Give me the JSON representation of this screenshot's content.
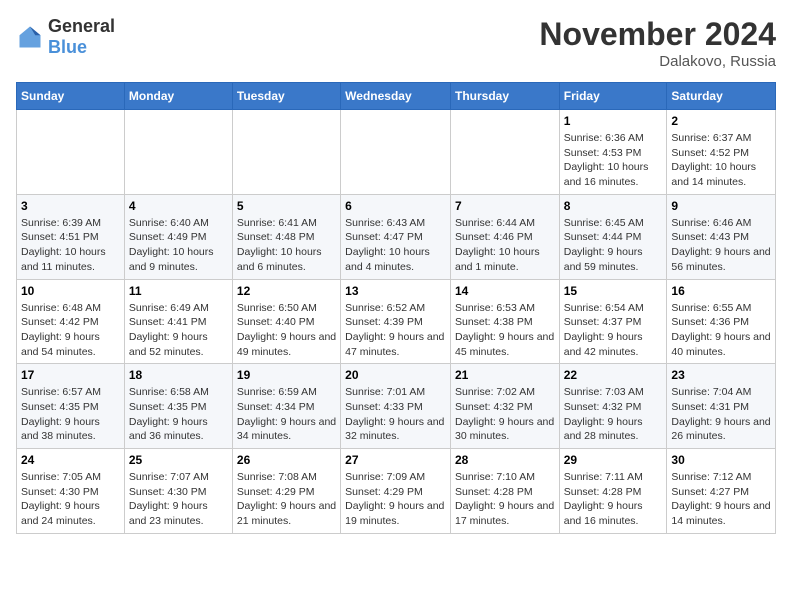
{
  "logo": {
    "general": "General",
    "blue": "Blue"
  },
  "title": "November 2024",
  "location": "Dalakovo, Russia",
  "days_header": [
    "Sunday",
    "Monday",
    "Tuesday",
    "Wednesday",
    "Thursday",
    "Friday",
    "Saturday"
  ],
  "weeks": [
    [
      {
        "day": "",
        "info": ""
      },
      {
        "day": "",
        "info": ""
      },
      {
        "day": "",
        "info": ""
      },
      {
        "day": "",
        "info": ""
      },
      {
        "day": "",
        "info": ""
      },
      {
        "day": "1",
        "info": "Sunrise: 6:36 AM\nSunset: 4:53 PM\nDaylight: 10 hours and 16 minutes."
      },
      {
        "day": "2",
        "info": "Sunrise: 6:37 AM\nSunset: 4:52 PM\nDaylight: 10 hours and 14 minutes."
      }
    ],
    [
      {
        "day": "3",
        "info": "Sunrise: 6:39 AM\nSunset: 4:51 PM\nDaylight: 10 hours and 11 minutes."
      },
      {
        "day": "4",
        "info": "Sunrise: 6:40 AM\nSunset: 4:49 PM\nDaylight: 10 hours and 9 minutes."
      },
      {
        "day": "5",
        "info": "Sunrise: 6:41 AM\nSunset: 4:48 PM\nDaylight: 10 hours and 6 minutes."
      },
      {
        "day": "6",
        "info": "Sunrise: 6:43 AM\nSunset: 4:47 PM\nDaylight: 10 hours and 4 minutes."
      },
      {
        "day": "7",
        "info": "Sunrise: 6:44 AM\nSunset: 4:46 PM\nDaylight: 10 hours and 1 minute."
      },
      {
        "day": "8",
        "info": "Sunrise: 6:45 AM\nSunset: 4:44 PM\nDaylight: 9 hours and 59 minutes."
      },
      {
        "day": "9",
        "info": "Sunrise: 6:46 AM\nSunset: 4:43 PM\nDaylight: 9 hours and 56 minutes."
      }
    ],
    [
      {
        "day": "10",
        "info": "Sunrise: 6:48 AM\nSunset: 4:42 PM\nDaylight: 9 hours and 54 minutes."
      },
      {
        "day": "11",
        "info": "Sunrise: 6:49 AM\nSunset: 4:41 PM\nDaylight: 9 hours and 52 minutes."
      },
      {
        "day": "12",
        "info": "Sunrise: 6:50 AM\nSunset: 4:40 PM\nDaylight: 9 hours and 49 minutes."
      },
      {
        "day": "13",
        "info": "Sunrise: 6:52 AM\nSunset: 4:39 PM\nDaylight: 9 hours and 47 minutes."
      },
      {
        "day": "14",
        "info": "Sunrise: 6:53 AM\nSunset: 4:38 PM\nDaylight: 9 hours and 45 minutes."
      },
      {
        "day": "15",
        "info": "Sunrise: 6:54 AM\nSunset: 4:37 PM\nDaylight: 9 hours and 42 minutes."
      },
      {
        "day": "16",
        "info": "Sunrise: 6:55 AM\nSunset: 4:36 PM\nDaylight: 9 hours and 40 minutes."
      }
    ],
    [
      {
        "day": "17",
        "info": "Sunrise: 6:57 AM\nSunset: 4:35 PM\nDaylight: 9 hours and 38 minutes."
      },
      {
        "day": "18",
        "info": "Sunrise: 6:58 AM\nSunset: 4:35 PM\nDaylight: 9 hours and 36 minutes."
      },
      {
        "day": "19",
        "info": "Sunrise: 6:59 AM\nSunset: 4:34 PM\nDaylight: 9 hours and 34 minutes."
      },
      {
        "day": "20",
        "info": "Sunrise: 7:01 AM\nSunset: 4:33 PM\nDaylight: 9 hours and 32 minutes."
      },
      {
        "day": "21",
        "info": "Sunrise: 7:02 AM\nSunset: 4:32 PM\nDaylight: 9 hours and 30 minutes."
      },
      {
        "day": "22",
        "info": "Sunrise: 7:03 AM\nSunset: 4:32 PM\nDaylight: 9 hours and 28 minutes."
      },
      {
        "day": "23",
        "info": "Sunrise: 7:04 AM\nSunset: 4:31 PM\nDaylight: 9 hours and 26 minutes."
      }
    ],
    [
      {
        "day": "24",
        "info": "Sunrise: 7:05 AM\nSunset: 4:30 PM\nDaylight: 9 hours and 24 minutes."
      },
      {
        "day": "25",
        "info": "Sunrise: 7:07 AM\nSunset: 4:30 PM\nDaylight: 9 hours and 23 minutes."
      },
      {
        "day": "26",
        "info": "Sunrise: 7:08 AM\nSunset: 4:29 PM\nDaylight: 9 hours and 21 minutes."
      },
      {
        "day": "27",
        "info": "Sunrise: 7:09 AM\nSunset: 4:29 PM\nDaylight: 9 hours and 19 minutes."
      },
      {
        "day": "28",
        "info": "Sunrise: 7:10 AM\nSunset: 4:28 PM\nDaylight: 9 hours and 17 minutes."
      },
      {
        "day": "29",
        "info": "Sunrise: 7:11 AM\nSunset: 4:28 PM\nDaylight: 9 hours and 16 minutes."
      },
      {
        "day": "30",
        "info": "Sunrise: 7:12 AM\nSunset: 4:27 PM\nDaylight: 9 hours and 14 minutes."
      }
    ]
  ]
}
